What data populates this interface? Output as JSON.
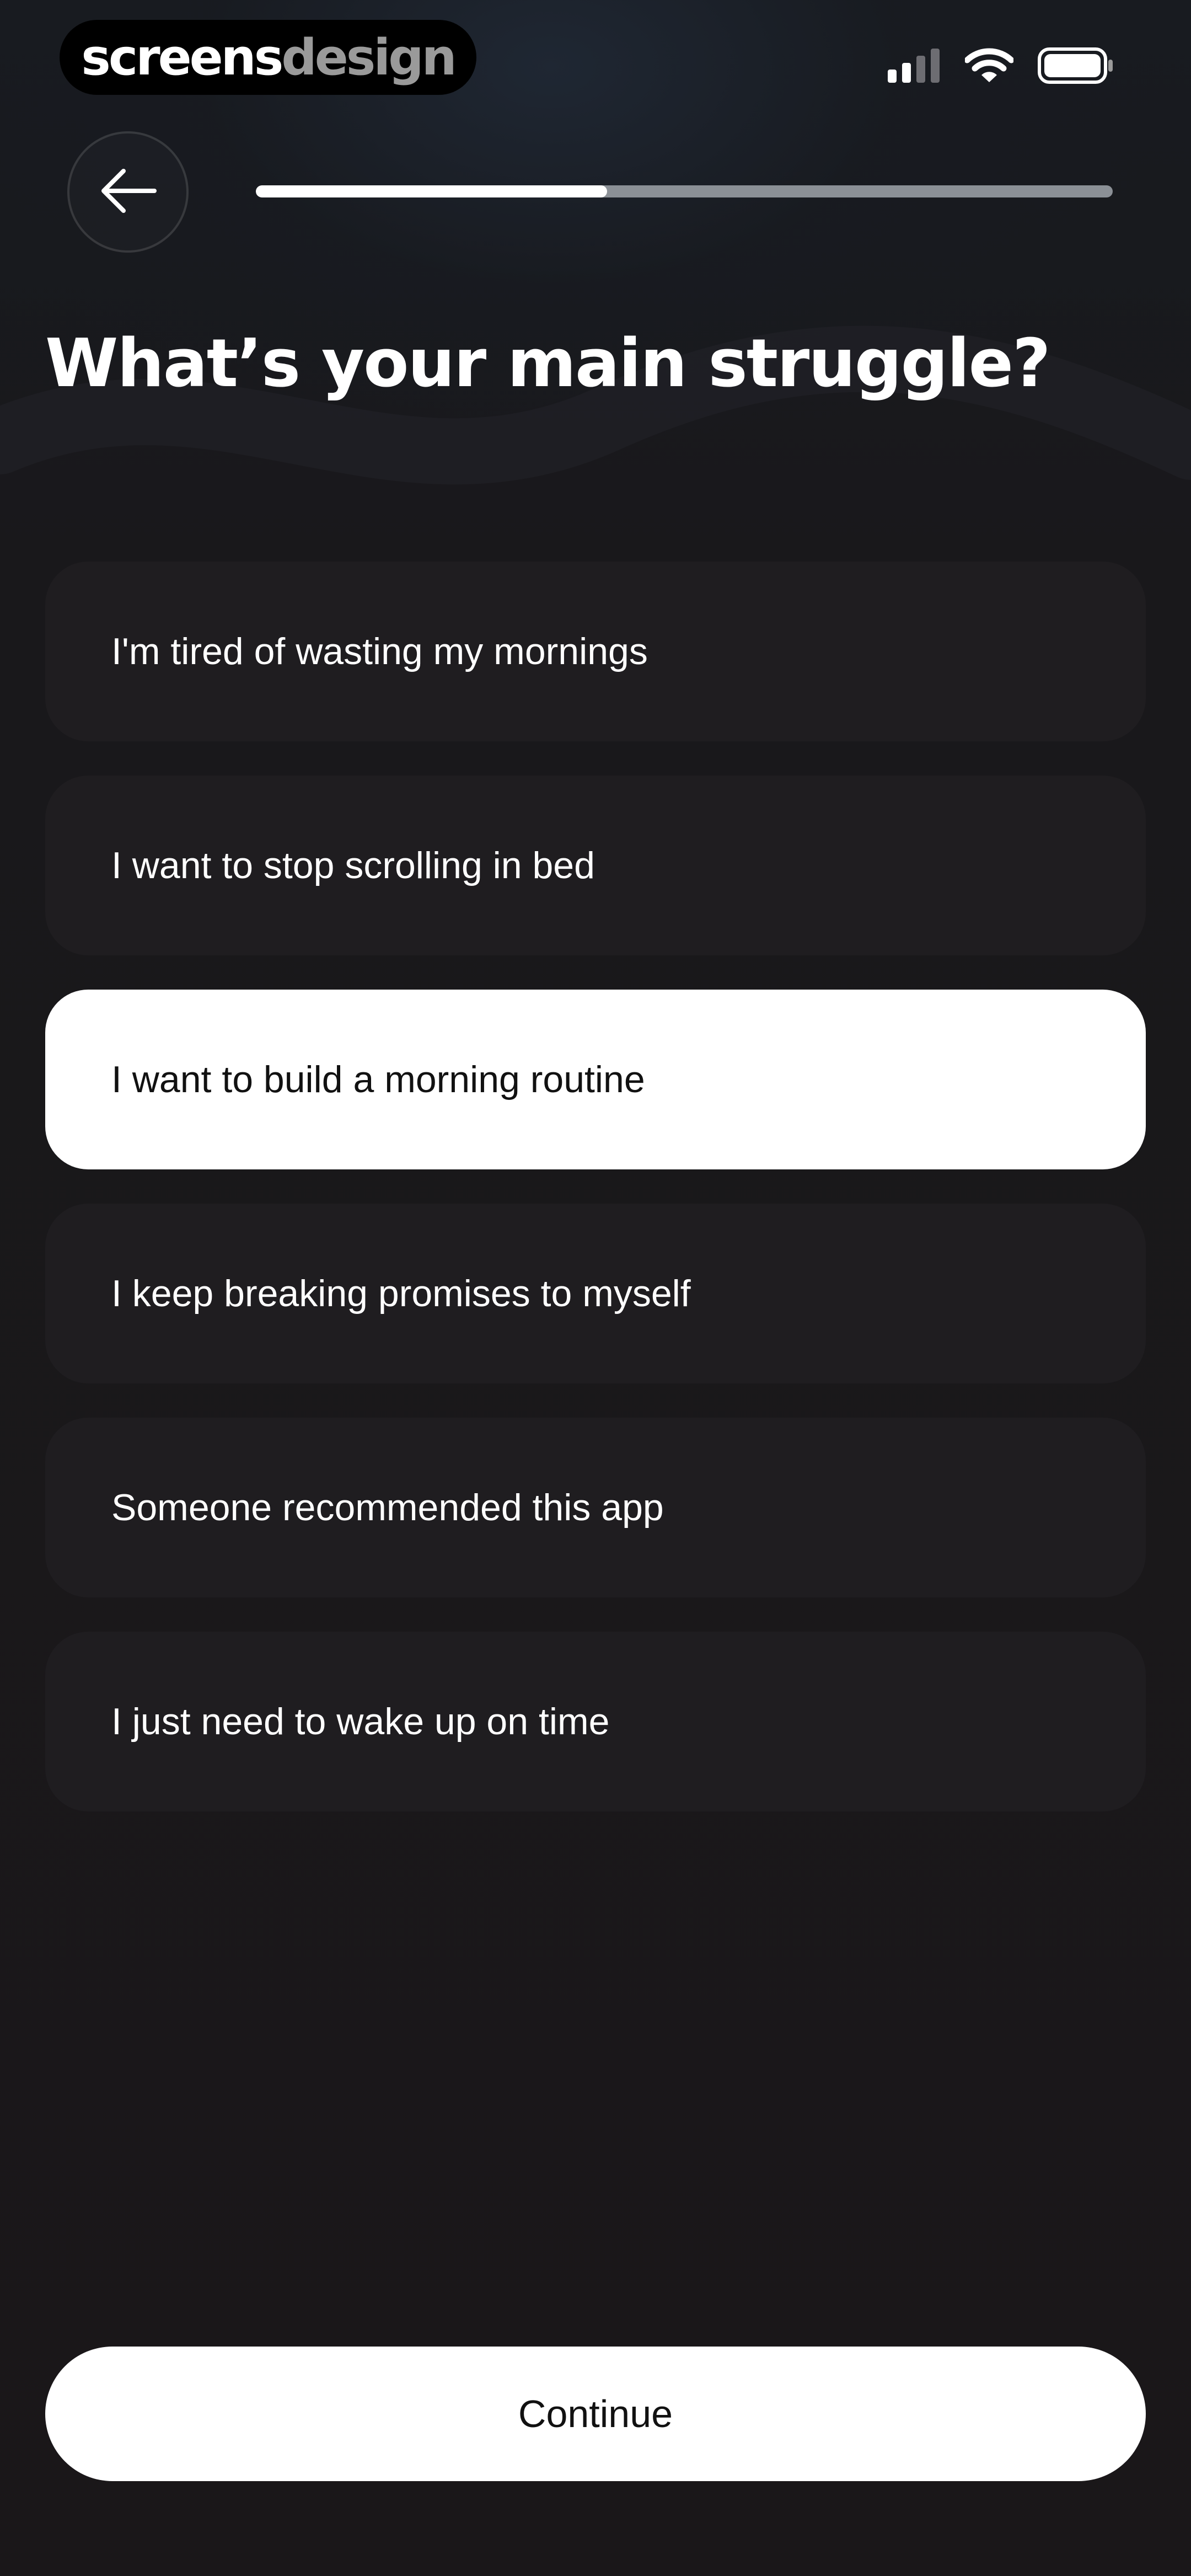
{
  "brand": {
    "part1": "screens",
    "part2": "design"
  },
  "status_bar": {
    "signal_icon": "cellular-signal-icon",
    "wifi_icon": "wifi-icon",
    "battery_icon": "battery-icon"
  },
  "header": {
    "back_icon": "arrow-left-icon",
    "progress": 0.41
  },
  "title": "What’s your main struggle?",
  "options": [
    {
      "label": "I'm tired of wasting my mornings",
      "selected": false
    },
    {
      "label": "I want to stop scrolling in bed",
      "selected": false
    },
    {
      "label": "I want to build a morning routine",
      "selected": true
    },
    {
      "label": "I keep breaking promises to myself",
      "selected": false
    },
    {
      "label": "Someone recommended this app",
      "selected": false
    },
    {
      "label": "I just need to wake up on time",
      "selected": false
    }
  ],
  "continue_label": "Continue",
  "colors": {
    "background": "#19181b",
    "option_bg": "#1f1d20",
    "selected_bg": "#ffffff",
    "progress_track": "#8b9096",
    "progress_fill": "#ffffff"
  }
}
